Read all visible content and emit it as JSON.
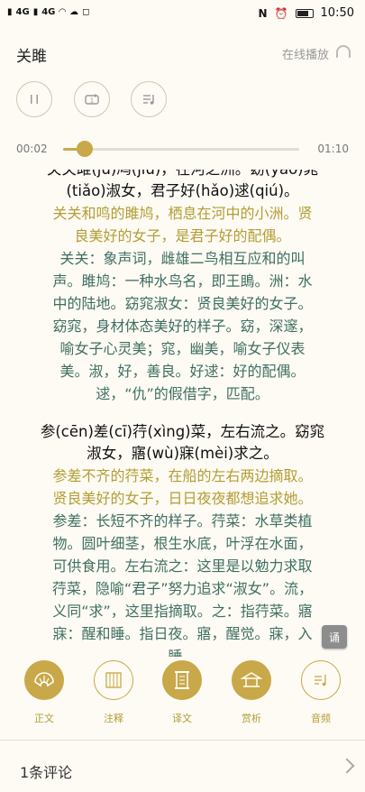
{
  "status_bar": {
    "left_signals": [
      "4G",
      "4G"
    ],
    "time": "10:50"
  },
  "header": {
    "title": "关雎",
    "online_play": "在线播放"
  },
  "player": {
    "current_time": "00:02",
    "total_time": "01:10",
    "progress": 0.09
  },
  "content": {
    "section1": {
      "orig": [
        "关关雎(jū)鸠(jiū)，在河之洲。窈(yǎo)窕",
        "(tiǎo)淑女，君子好(hǎo)逑(qiú)。"
      ],
      "trans": [
        "关关和鸣的雎鸠，栖息在河中的小洲。贤",
        "良美好的女子，是君子好的配偶。"
      ],
      "note": [
        "关关：象声词，雌雄二鸟相互应和的叫",
        "声。雎鸠：一种水鸟名，即王鴡。洲：水",
        "中的陆地。窈窕淑女：贤良美好的女子。",
        "窈窕，身材体态美好的样子。窈，深邃，",
        "喻女子心灵美；窕，幽美，喻女子仪表",
        "美。淑，好，善良。好逑：好的配偶。",
        "逑，“仇”的假借字，匹配。"
      ]
    },
    "section2": {
      "orig": [
        "参(cēn)差(cī)荇(xìng)菜，左右流之。窈窕",
        "淑女，寤(wù)寐(mèi)求之。"
      ],
      "trans": [
        "参差不齐的荇菜，在船的左右两边摘取。",
        "贤良美好的女子，日日夜夜都想追求她。"
      ],
      "note": [
        "参差：长短不齐的样子。荇菜：水草类植",
        "物。圆叶细茎，根生水底，叶浮在水面，",
        "可供食用。左右流之：这里是以勉力求取",
        "荇菜，隐喻“君子”努力追求“淑女”。流，",
        "义同“求”，这里指摘取。之：指荇菜。寤",
        "寐：醒和睡。指日夜。寤，醒觉。寐，入",
        "睡。"
      ]
    }
  },
  "float_button": "诵",
  "tabs": [
    {
      "label": "正文",
      "icon": "fan-icon"
    },
    {
      "label": "注释",
      "icon": "bamboo-slip-icon"
    },
    {
      "label": "译文",
      "icon": "scroll-icon"
    },
    {
      "label": "赏析",
      "icon": "pavilion-icon"
    },
    {
      "label": "音频",
      "icon": "audio-icon"
    }
  ],
  "comments": {
    "label": "1条评论"
  },
  "colors": {
    "accent": "#c8a848",
    "translation_text": "#b39d34",
    "note_text": "#3f6f62",
    "background": "#fdfbf4"
  }
}
